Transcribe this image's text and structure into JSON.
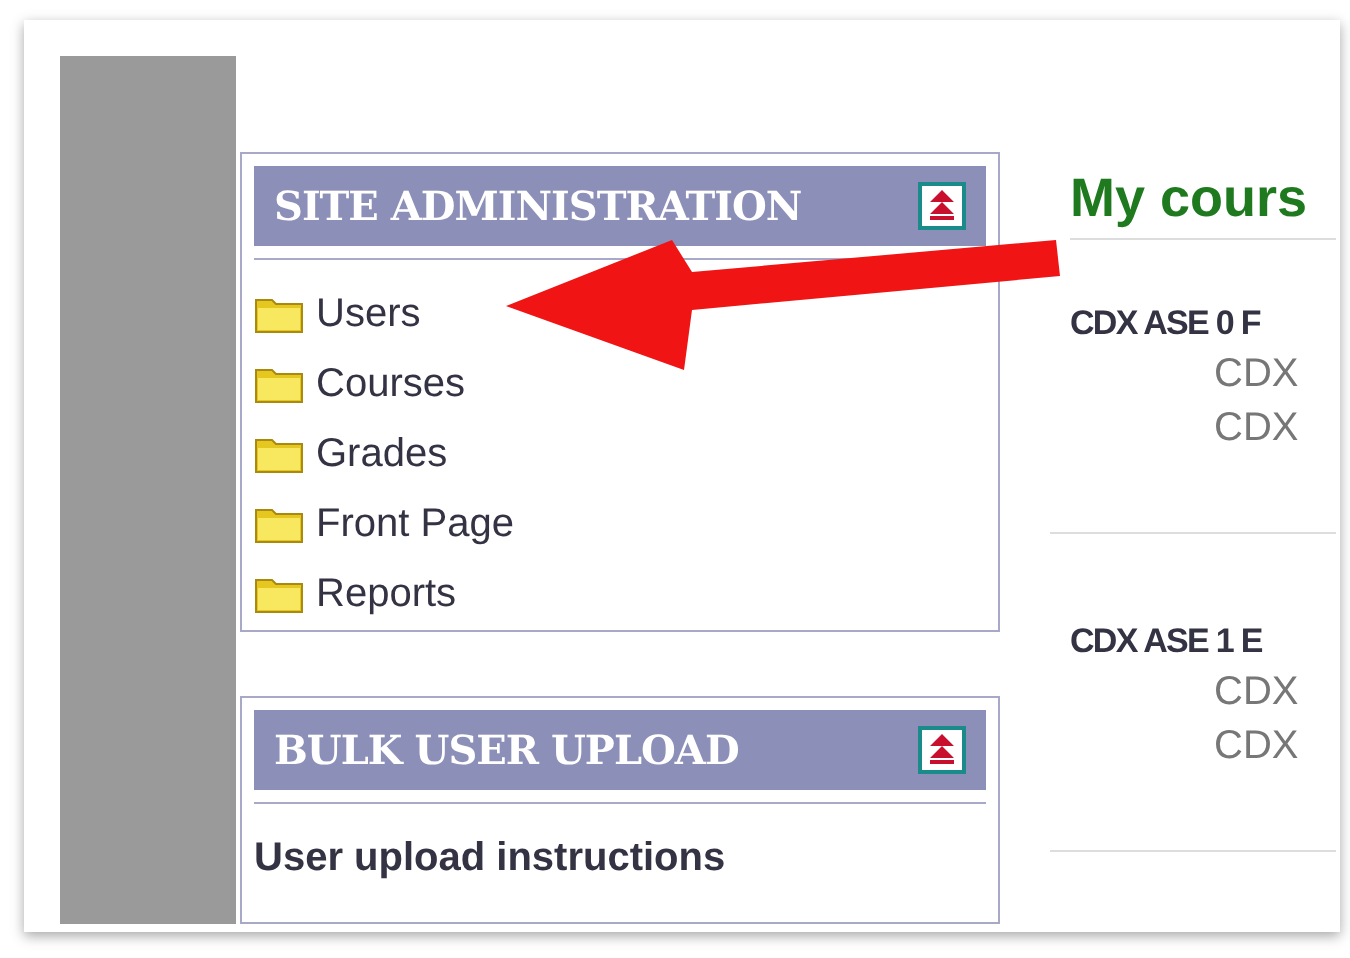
{
  "blocks": [
    {
      "title": "SITE ADMINISTRATION",
      "kind": "folders",
      "items": [
        "Users",
        "Courses",
        "Grades",
        "Front Page",
        "Reports"
      ]
    },
    {
      "title": "BULK USER UPLOAD",
      "kind": "links",
      "items": [
        "User upload instructions"
      ]
    }
  ],
  "main": {
    "heading": "My cours",
    "courses": [
      {
        "name": "CDX ASE 0 F",
        "lines": [
          "CDX",
          "CDX"
        ]
      },
      {
        "name": "CDX ASE 1 E",
        "lines": [
          "CDX",
          "CDX"
        ]
      }
    ]
  }
}
